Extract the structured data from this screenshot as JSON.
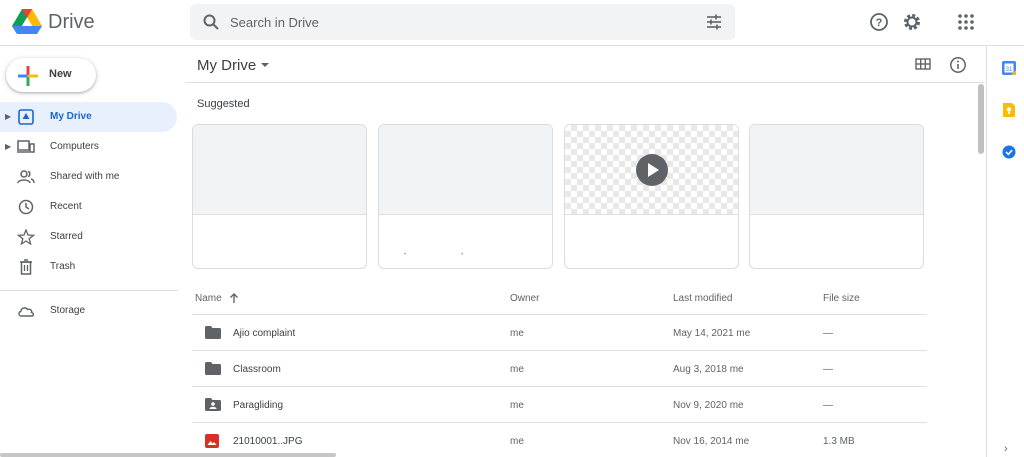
{
  "header": {
    "brand": "Drive",
    "search_placeholder": "Search in Drive",
    "icons": [
      "help-icon",
      "settings-icon",
      "apps-icon"
    ]
  },
  "sidebar": {
    "new_label": "New",
    "items": [
      {
        "label": "My Drive",
        "icon": "my-drive-icon",
        "active": true
      },
      {
        "label": "Computers",
        "icon": "computers-icon"
      },
      {
        "label": "Shared with me",
        "icon": "shared-icon"
      },
      {
        "label": "Recent",
        "icon": "recent-icon"
      },
      {
        "label": "Starred",
        "icon": "star-icon"
      },
      {
        "label": "Trash",
        "icon": "trash-icon"
      },
      {
        "label": "Storage",
        "icon": "cloud-icon"
      }
    ]
  },
  "main": {
    "title": "My Drive",
    "suggested_label": "Suggested",
    "table": {
      "columns": [
        "Name",
        "Owner",
        "Last modified",
        "File size"
      ],
      "rows": [
        {
          "name": "Ajio complaint",
          "owner": "me",
          "modified": "May 14, 2021 me",
          "size": "—",
          "icon": "folder-icon"
        },
        {
          "name": "Classroom",
          "owner": "me",
          "modified": "Aug 3, 2018 me",
          "size": "—",
          "icon": "folder-icon"
        },
        {
          "name": "Paragliding",
          "owner": "me",
          "modified": "Nov 9, 2020 me",
          "size": "—",
          "icon": "shared-folder-icon"
        },
        {
          "name": "21010001..JPG",
          "owner": "me",
          "modified": "Nov 16, 2014 me",
          "size": "1.3 MB",
          "icon": "image-file-icon"
        }
      ]
    }
  },
  "colors": {
    "accent": "#1967d2",
    "active_bg": "#e8f0fe",
    "folder": "#5f6368",
    "image_file": "#d93025"
  }
}
